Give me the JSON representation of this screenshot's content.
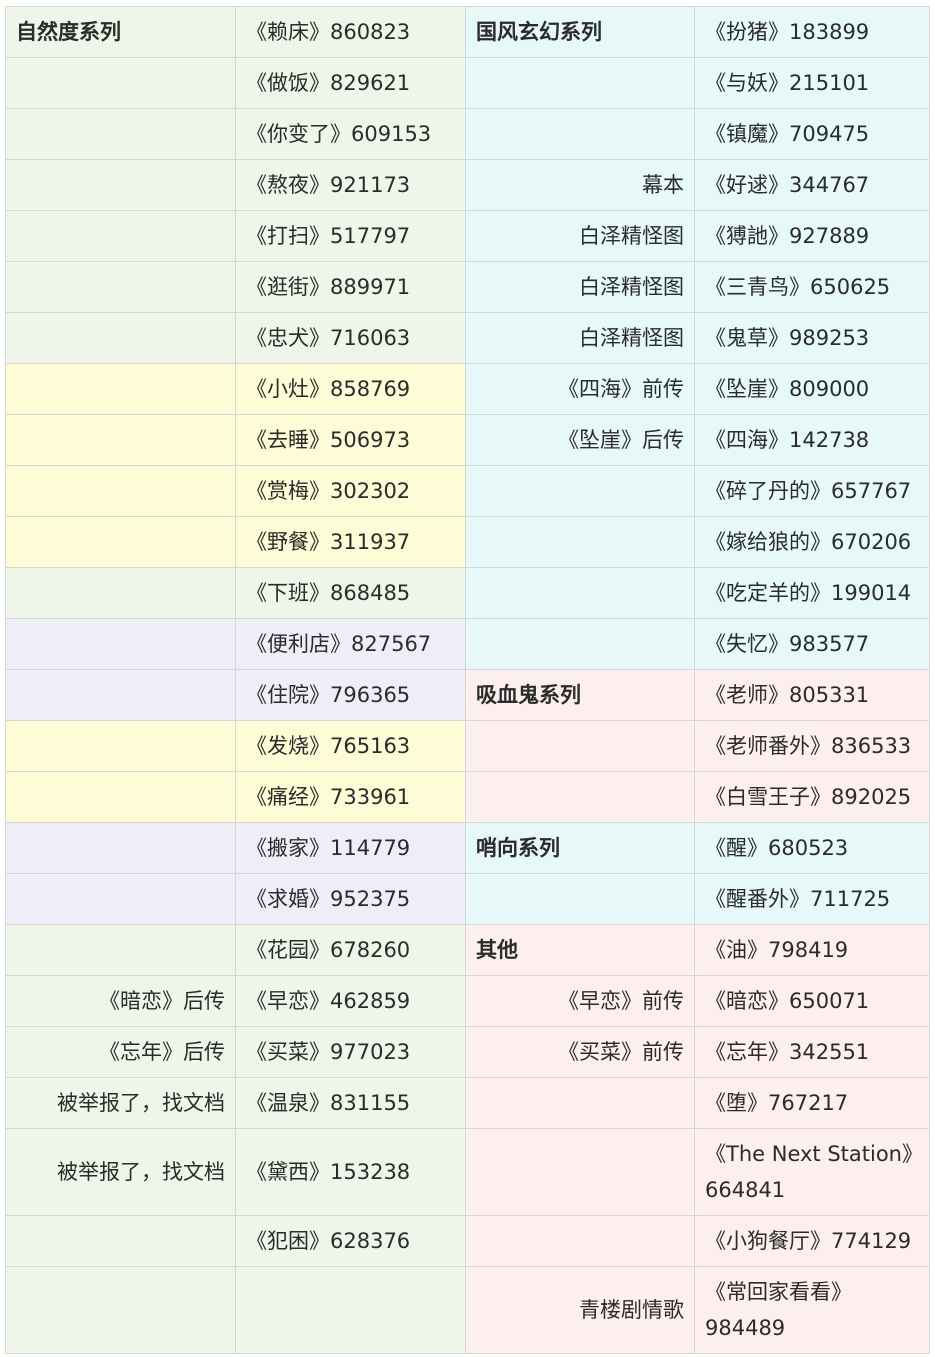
{
  "colors": {
    "green": "#eef5e9",
    "yellow": "#fefbd7",
    "lavender": "#efeef8",
    "cyan": "#e7f8f8",
    "pink": "#fcefee",
    "note_text": "#999999",
    "border": "#d6d6d6"
  },
  "rows": [
    {
      "c1": {
        "text": "自然度系列",
        "bg": "green",
        "kind": "head"
      },
      "c2": {
        "text": "《赖床》860823",
        "bg": "green"
      },
      "c3": {
        "text": "国风玄幻系列",
        "bg": "cyan",
        "kind": "head"
      },
      "c4": {
        "text": "《扮猪》183899",
        "bg": "cyan"
      }
    },
    {
      "c1": {
        "text": "",
        "bg": "green"
      },
      "c2": {
        "text": "《做饭》829621",
        "bg": "green"
      },
      "c3": {
        "text": "",
        "bg": "cyan"
      },
      "c4": {
        "text": "《与妖》215101",
        "bg": "cyan"
      }
    },
    {
      "c1": {
        "text": "",
        "bg": "green"
      },
      "c2": {
        "text": "《你变了》609153",
        "bg": "green"
      },
      "c3": {
        "text": "",
        "bg": "cyan"
      },
      "c4": {
        "text": "《镇魔》709475",
        "bg": "cyan"
      }
    },
    {
      "c1": {
        "text": "",
        "bg": "green"
      },
      "c2": {
        "text": "《熬夜》921173",
        "bg": "green"
      },
      "c3": {
        "text": "幕本",
        "bg": "cyan",
        "kind": "note"
      },
      "c4": {
        "text": "《好逑》344767",
        "bg": "cyan"
      }
    },
    {
      "c1": {
        "text": "",
        "bg": "green"
      },
      "c2": {
        "text": "《打扫》517797",
        "bg": "green"
      },
      "c3": {
        "text": "白泽精怪图",
        "bg": "cyan",
        "kind": "note"
      },
      "c4": {
        "text": "《猼訑》927889",
        "bg": "cyan"
      }
    },
    {
      "c1": {
        "text": "",
        "bg": "green"
      },
      "c2": {
        "text": "《逛街》889971",
        "bg": "green"
      },
      "c3": {
        "text": "白泽精怪图",
        "bg": "cyan",
        "kind": "note"
      },
      "c4": {
        "text": "《三青鸟》650625",
        "bg": "cyan"
      }
    },
    {
      "c1": {
        "text": "",
        "bg": "green"
      },
      "c2": {
        "text": "《忠犬》716063",
        "bg": "green"
      },
      "c3": {
        "text": "白泽精怪图",
        "bg": "cyan",
        "kind": "note"
      },
      "c4": {
        "text": "《鬼草》989253",
        "bg": "cyan"
      }
    },
    {
      "c1": {
        "text": "",
        "bg": "yellow"
      },
      "c2": {
        "text": "《小灶》858769",
        "bg": "yellow"
      },
      "c3": {
        "text": "《四海》前传",
        "bg": "cyan",
        "kind": "note"
      },
      "c4": {
        "text": "《坠崖》809000",
        "bg": "cyan"
      }
    },
    {
      "c1": {
        "text": "",
        "bg": "yellow"
      },
      "c2": {
        "text": "《去睡》506973",
        "bg": "yellow"
      },
      "c3": {
        "text": "《坠崖》后传",
        "bg": "cyan",
        "kind": "note"
      },
      "c4": {
        "text": "《四海》142738",
        "bg": "cyan"
      }
    },
    {
      "c1": {
        "text": "",
        "bg": "yellow"
      },
      "c2": {
        "text": "《赏梅》302302",
        "bg": "yellow"
      },
      "c3": {
        "text": "",
        "bg": "cyan"
      },
      "c4": {
        "text": "《碎了丹的》657767",
        "bg": "cyan"
      }
    },
    {
      "c1": {
        "text": "",
        "bg": "yellow"
      },
      "c2": {
        "text": "《野餐》311937",
        "bg": "yellow"
      },
      "c3": {
        "text": "",
        "bg": "cyan"
      },
      "c4": {
        "text": "《嫁给狼的》670206",
        "bg": "cyan"
      }
    },
    {
      "c1": {
        "text": "",
        "bg": "green"
      },
      "c2": {
        "text": "《下班》868485",
        "bg": "green"
      },
      "c3": {
        "text": "",
        "bg": "cyan"
      },
      "c4": {
        "text": "《吃定羊的》199014",
        "bg": "cyan"
      }
    },
    {
      "c1": {
        "text": "",
        "bg": "lavender"
      },
      "c2": {
        "text": "《便利店》827567",
        "bg": "lavender"
      },
      "c3": {
        "text": "",
        "bg": "cyan"
      },
      "c4": {
        "text": "《失忆》983577",
        "bg": "cyan"
      }
    },
    {
      "c1": {
        "text": "",
        "bg": "lavender"
      },
      "c2": {
        "text": "《住院》796365",
        "bg": "lavender"
      },
      "c3": {
        "text": "吸血鬼系列",
        "bg": "pink",
        "kind": "head"
      },
      "c4": {
        "text": "《老师》805331",
        "bg": "pink"
      }
    },
    {
      "c1": {
        "text": "",
        "bg": "yellow"
      },
      "c2": {
        "text": "《发烧》765163",
        "bg": "yellow"
      },
      "c3": {
        "text": "",
        "bg": "pink"
      },
      "c4": {
        "text": "《老师番外》836533",
        "bg": "pink"
      }
    },
    {
      "c1": {
        "text": "",
        "bg": "yellow"
      },
      "c2": {
        "text": "《痛经》733961",
        "bg": "yellow"
      },
      "c3": {
        "text": "",
        "bg": "pink"
      },
      "c4": {
        "text": "《白雪王子》892025",
        "bg": "pink"
      }
    },
    {
      "c1": {
        "text": "",
        "bg": "lavender"
      },
      "c2": {
        "text": "《搬家》114779",
        "bg": "lavender"
      },
      "c3": {
        "text": "哨向系列",
        "bg": "cyan",
        "kind": "head"
      },
      "c4": {
        "text": "《醒》680523",
        "bg": "cyan"
      }
    },
    {
      "c1": {
        "text": "",
        "bg": "lavender"
      },
      "c2": {
        "text": "《求婚》952375",
        "bg": "lavender"
      },
      "c3": {
        "text": "",
        "bg": "cyan"
      },
      "c4": {
        "text": "《醒番外》711725",
        "bg": "cyan"
      }
    },
    {
      "c1": {
        "text": "",
        "bg": "green"
      },
      "c2": {
        "text": "《花园》678260",
        "bg": "green"
      },
      "c3": {
        "text": "其他",
        "bg": "pink",
        "kind": "head"
      },
      "c4": {
        "text": "《油》798419",
        "bg": "pink"
      }
    },
    {
      "c1": {
        "text": "《暗恋》后传",
        "bg": "green",
        "kind": "note"
      },
      "c2": {
        "text": "《早恋》462859",
        "bg": "green"
      },
      "c3": {
        "text": "《早恋》前传",
        "bg": "pink",
        "kind": "note"
      },
      "c4": {
        "text": "《暗恋》650071",
        "bg": "pink"
      }
    },
    {
      "c1": {
        "text": "《忘年》后传",
        "bg": "green",
        "kind": "note"
      },
      "c2": {
        "text": "《买菜》977023",
        "bg": "green"
      },
      "c3": {
        "text": "《买菜》前传",
        "bg": "pink",
        "kind": "note"
      },
      "c4": {
        "text": "《忘年》342551",
        "bg": "pink"
      }
    },
    {
      "c1": {
        "text": "被举报了，找文档",
        "bg": "green",
        "kind": "note"
      },
      "c2": {
        "text": "《温泉》831155",
        "bg": "green"
      },
      "c3": {
        "text": "",
        "bg": "pink"
      },
      "c4": {
        "text": "《堕》767217",
        "bg": "pink"
      }
    },
    {
      "tall": true,
      "c1": {
        "text": "被举报了，找文档",
        "bg": "green",
        "kind": "note"
      },
      "c2": {
        "text": "《黛西》153238",
        "bg": "green"
      },
      "c3": {
        "text": "",
        "bg": "pink"
      },
      "c4": {
        "text": "《The Next Station》664841",
        "bg": "pink"
      }
    },
    {
      "c1": {
        "text": "",
        "bg": "green"
      },
      "c2": {
        "text": "《犯困》628376",
        "bg": "green"
      },
      "c3": {
        "text": "",
        "bg": "pink"
      },
      "c4": {
        "text": "《小狗餐厅》774129",
        "bg": "pink"
      }
    },
    {
      "tall": true,
      "c1": {
        "text": "",
        "bg": "green"
      },
      "c2": {
        "text": "",
        "bg": "green"
      },
      "c3": {
        "text": "青楼剧情歌",
        "bg": "pink",
        "kind": "note"
      },
      "c4": {
        "text": "《常回家看看》984489",
        "bg": "pink"
      }
    }
  ]
}
